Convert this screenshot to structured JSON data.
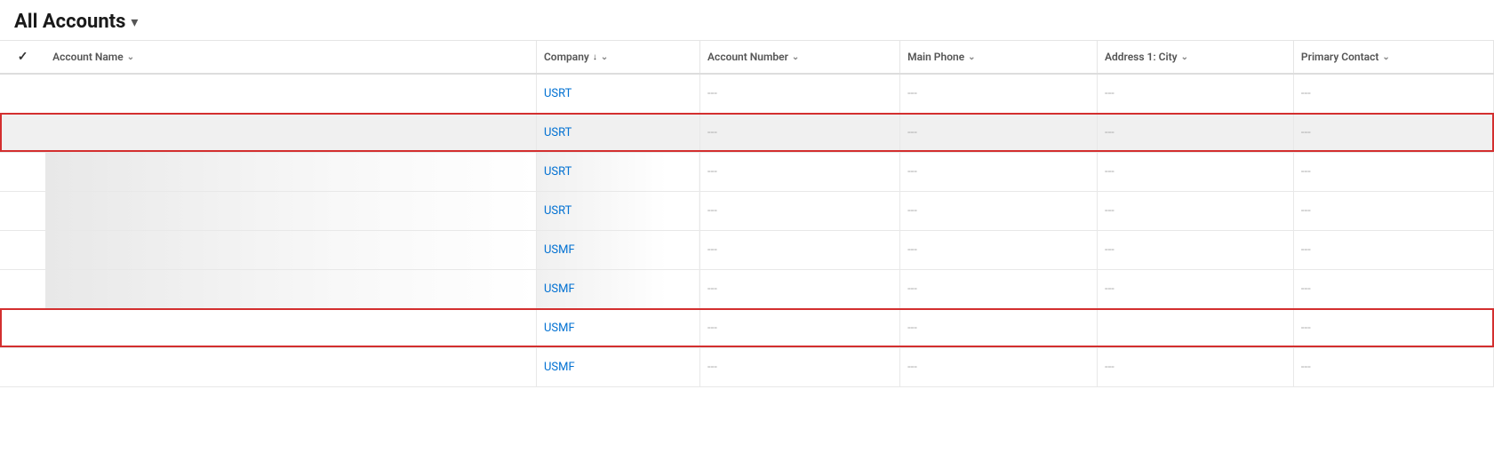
{
  "header": {
    "title": "All Accounts",
    "chevron": "▾"
  },
  "columns": [
    {
      "id": "check",
      "label": "",
      "sortable": false
    },
    {
      "id": "account-name",
      "label": "Account Name",
      "sortable": true,
      "sort_dir": ""
    },
    {
      "id": "company",
      "label": "Company",
      "sortable": true,
      "sort_dir": "↓"
    },
    {
      "id": "account-number",
      "label": "Account Number",
      "sortable": true,
      "sort_dir": ""
    },
    {
      "id": "main-phone",
      "label": "Main Phone",
      "sortable": true,
      "sort_dir": ""
    },
    {
      "id": "address-city",
      "label": "Address 1: City",
      "sortable": true,
      "sort_dir": ""
    },
    {
      "id": "primary-contact",
      "label": "Primary Contact",
      "sortable": true,
      "sort_dir": ""
    }
  ],
  "rows": [
    {
      "id": "row1",
      "check": "",
      "account_name": "",
      "company": "USRT",
      "account_number": "---",
      "main_phone": "---",
      "address_city": "---",
      "primary_contact": "---",
      "highlighted": false,
      "outlined": false,
      "partial": false
    },
    {
      "id": "row2",
      "check": "",
      "account_name": "",
      "company": "USRT",
      "account_number": "---",
      "main_phone": "---",
      "address_city": "---",
      "primary_contact": "---",
      "highlighted": true,
      "outlined": false,
      "partial": false
    },
    {
      "id": "row3",
      "check": "",
      "account_name": "",
      "company": "USRT",
      "account_number": "---",
      "main_phone": "---",
      "address_city": "---",
      "primary_contact": "---",
      "highlighted": false,
      "outlined": false,
      "partial": true
    },
    {
      "id": "row4",
      "check": "",
      "account_name": "",
      "company": "USRT",
      "account_number": "---",
      "main_phone": "---",
      "address_city": "---",
      "primary_contact": "---",
      "highlighted": false,
      "outlined": false,
      "partial": true
    },
    {
      "id": "row5",
      "check": "",
      "account_name": "",
      "company": "USMF",
      "account_number": "---",
      "main_phone": "---",
      "address_city": "---",
      "primary_contact": "---",
      "highlighted": false,
      "outlined": false,
      "partial": true
    },
    {
      "id": "row6",
      "check": "",
      "account_name": "",
      "company": "USMF",
      "account_number": "---",
      "main_phone": "---",
      "address_city": "---",
      "primary_contact": "---",
      "highlighted": false,
      "outlined": false,
      "partial": true
    },
    {
      "id": "row7",
      "check": "",
      "account_name": "",
      "company": "USMF",
      "account_number": "---",
      "main_phone": "---",
      "address_city": "---",
      "primary_contact": "---",
      "highlighted": false,
      "outlined": true,
      "partial": false
    },
    {
      "id": "row8",
      "check": "",
      "account_name": "",
      "company": "USMF",
      "account_number": "---",
      "main_phone": "---",
      "address_city": "---",
      "primary_contact": "---",
      "highlighted": false,
      "outlined": false,
      "partial": false
    }
  ],
  "empty_val": "---"
}
